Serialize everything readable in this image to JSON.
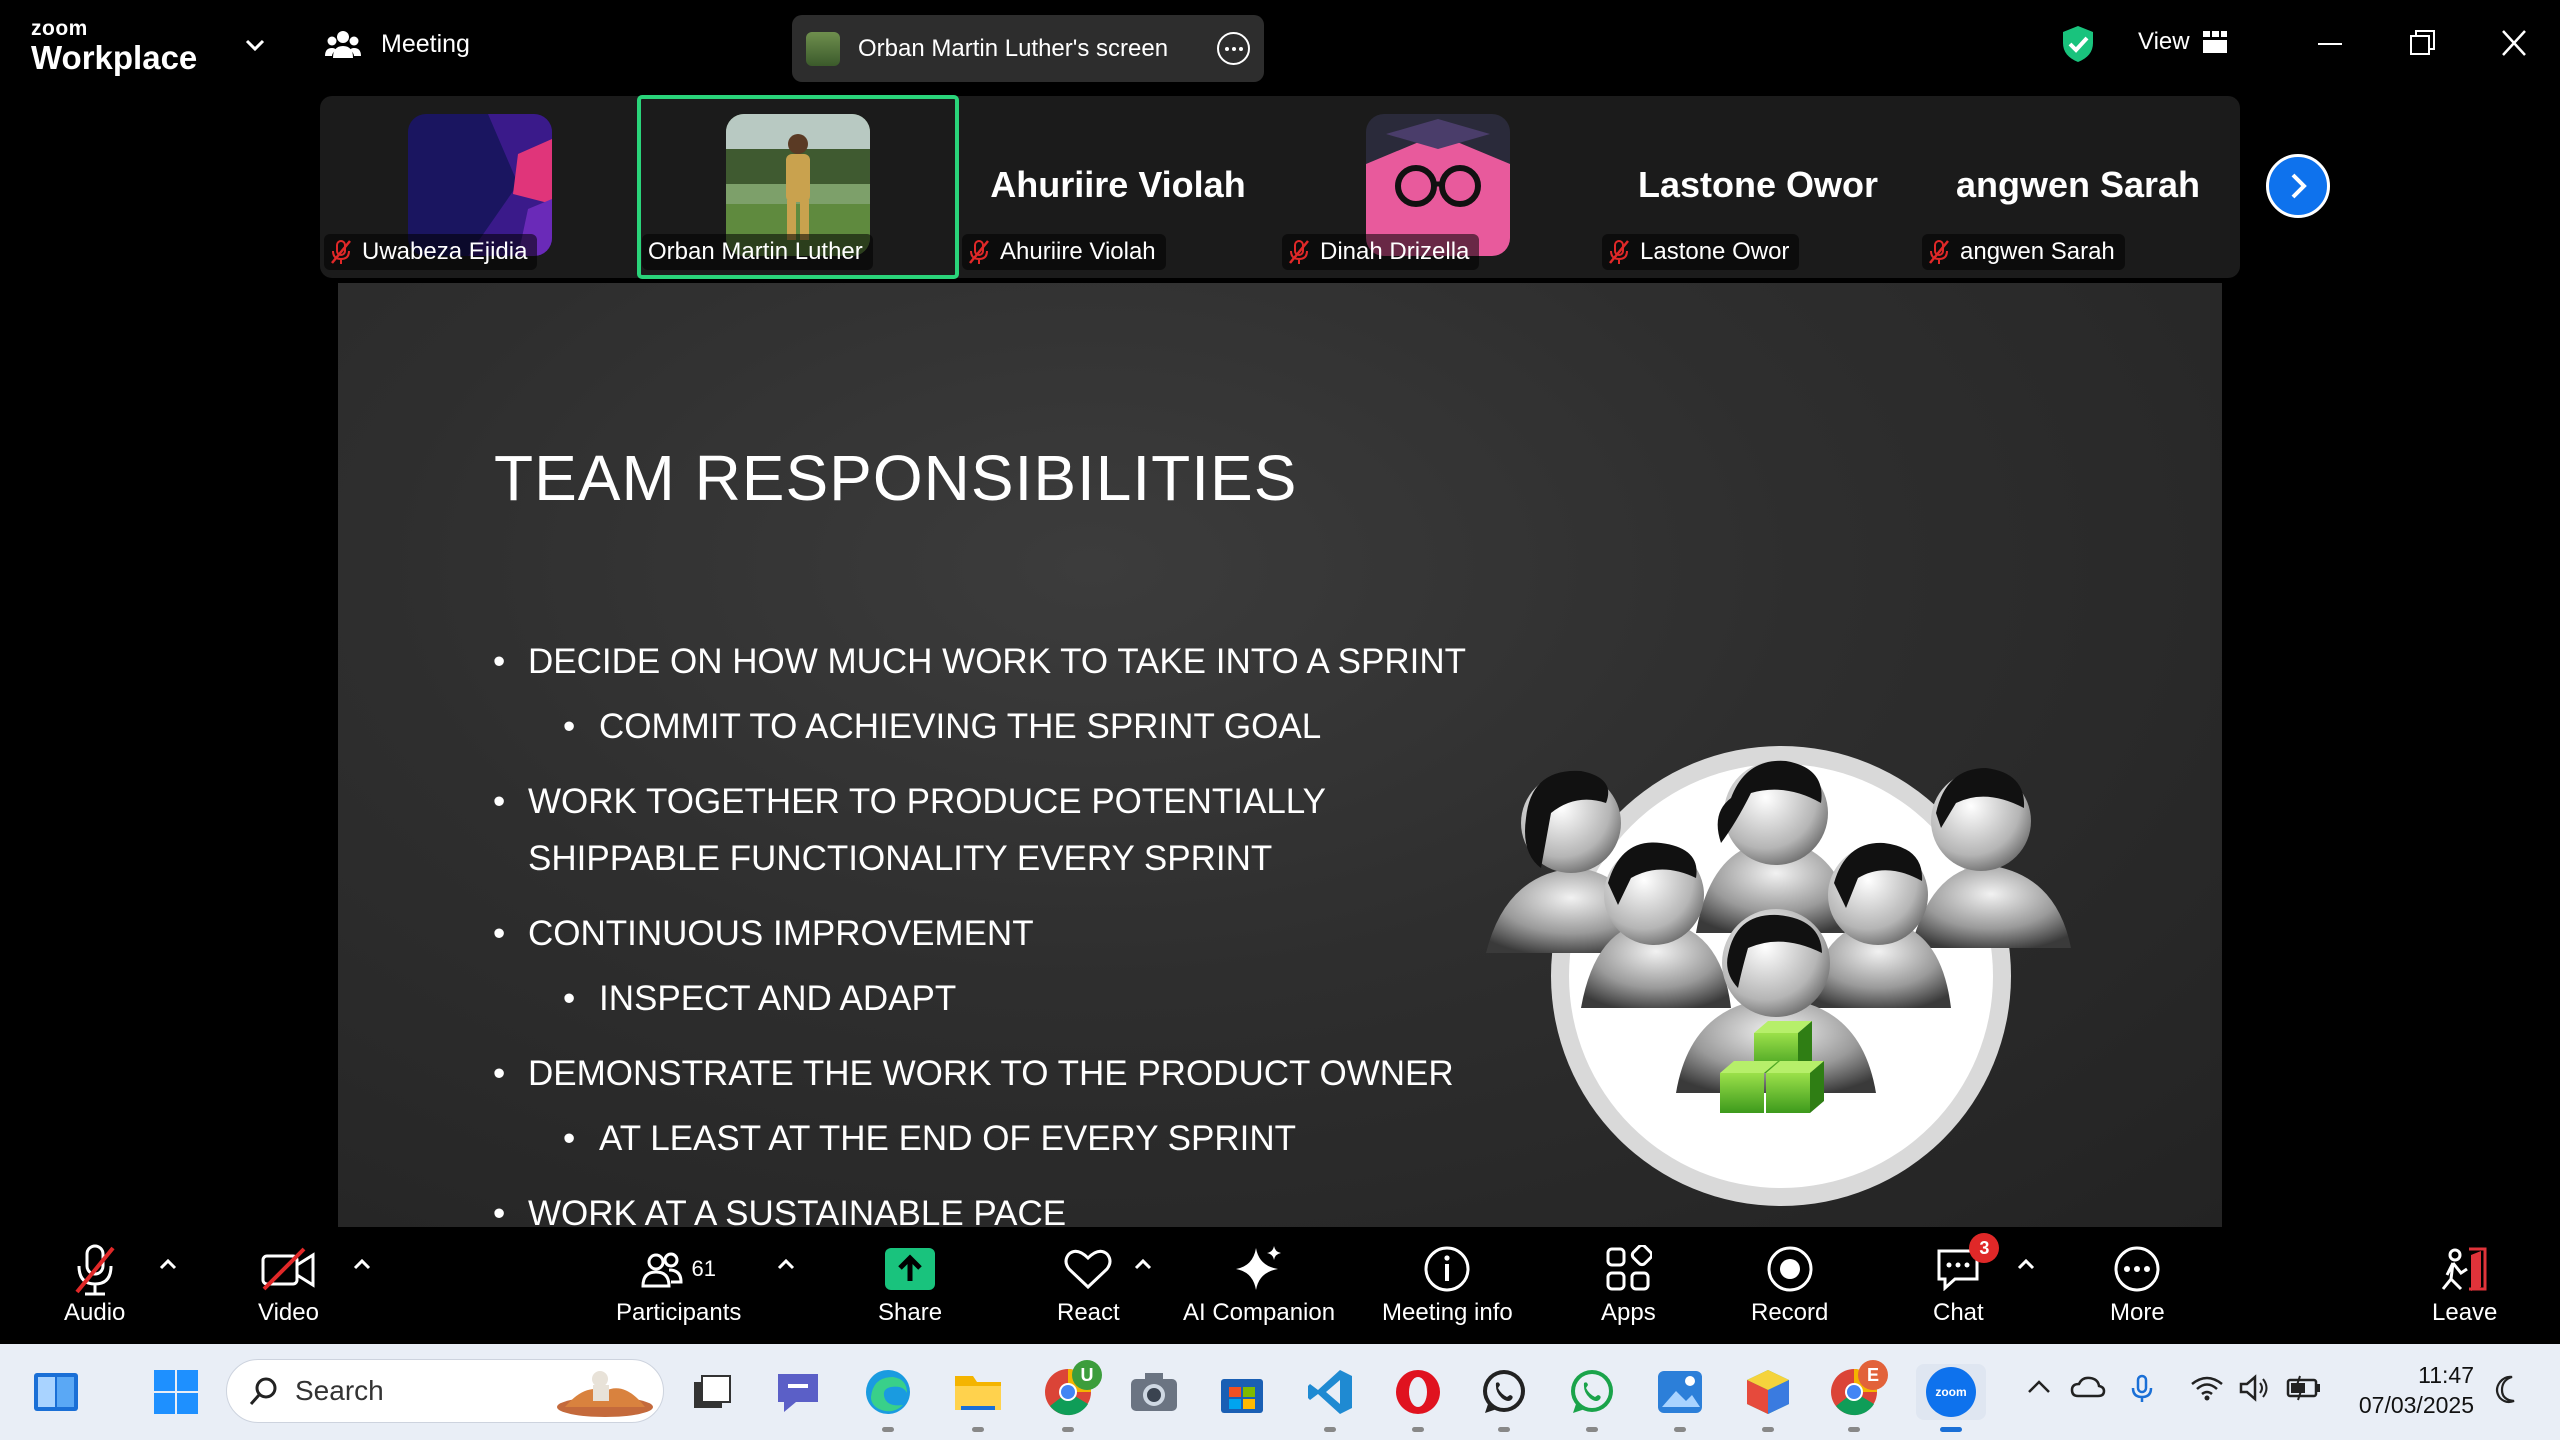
{
  "app": {
    "brand_small": "zoom",
    "brand_large": "Workplace",
    "meeting_label": "Meeting",
    "share_title": "Orban Martin Luther's screen",
    "view_label": "View"
  },
  "participants_strip": [
    {
      "name": "Uwabeza Ejidia",
      "display": "avatar",
      "muted": true
    },
    {
      "name": "Orban Martin Luther",
      "display": "photo",
      "muted": false,
      "active_speaker": true
    },
    {
      "name": "Ahuriire Violah",
      "display": "text",
      "big_name": "Ahuriire Violah",
      "muted": true
    },
    {
      "name": "Dinah Drizella",
      "display": "avatar",
      "muted": true
    },
    {
      "name": "Lastone Owor",
      "display": "text",
      "big_name": "Lastone Owor",
      "muted": true
    },
    {
      "name": "angwen Sarah",
      "display": "text",
      "big_name": "angwen Sarah",
      "muted": true
    }
  ],
  "slide": {
    "title": "TEAM RESPONSIBILITIES",
    "bullets": [
      {
        "level": 1,
        "text": "DECIDE ON HOW MUCH WORK TO TAKE INTO A SPRINT"
      },
      {
        "level": 2,
        "text": "COMMIT TO ACHIEVING THE SPRINT GOAL"
      },
      {
        "level": 1,
        "text": "WORK TOGETHER TO PRODUCE  POTENTIALLY SHIPPABLE FUNCTIONALITY EVERY SPRINT"
      },
      {
        "level": 1,
        "text": "CONTINUOUS IMPROVEMENT"
      },
      {
        "level": 2,
        "text": "INSPECT AND ADAPT"
      },
      {
        "level": 1,
        "text": "DEMONSTRATE THE WORK TO THE PRODUCT OWNER"
      },
      {
        "level": 2,
        "text": "AT LEAST AT THE END OF EVERY SPRINT"
      },
      {
        "level": 1,
        "text": "WORK AT A SUSTAINABLE PACE"
      }
    ]
  },
  "toolbar": {
    "audio": "Audio",
    "video": "Video",
    "participants": "Participants",
    "participant_count": "61",
    "share": "Share",
    "react": "React",
    "ai": "AI Companion",
    "info": "Meeting info",
    "apps": "Apps",
    "record": "Record",
    "chat": "Chat",
    "chat_badge": "3",
    "more": "More",
    "leave": "Leave"
  },
  "taskbar": {
    "search_placeholder": "Search",
    "time": "11:47",
    "date": "07/03/2025",
    "badges": {
      "teams_u": "U",
      "chrome_e": "E"
    }
  },
  "colors": {
    "active_speaker": "#2ad47a",
    "next_button": "#0e72ed",
    "share_green": "#19c37d",
    "muted_red": "#e02828",
    "leave_red": "#e0333a"
  }
}
